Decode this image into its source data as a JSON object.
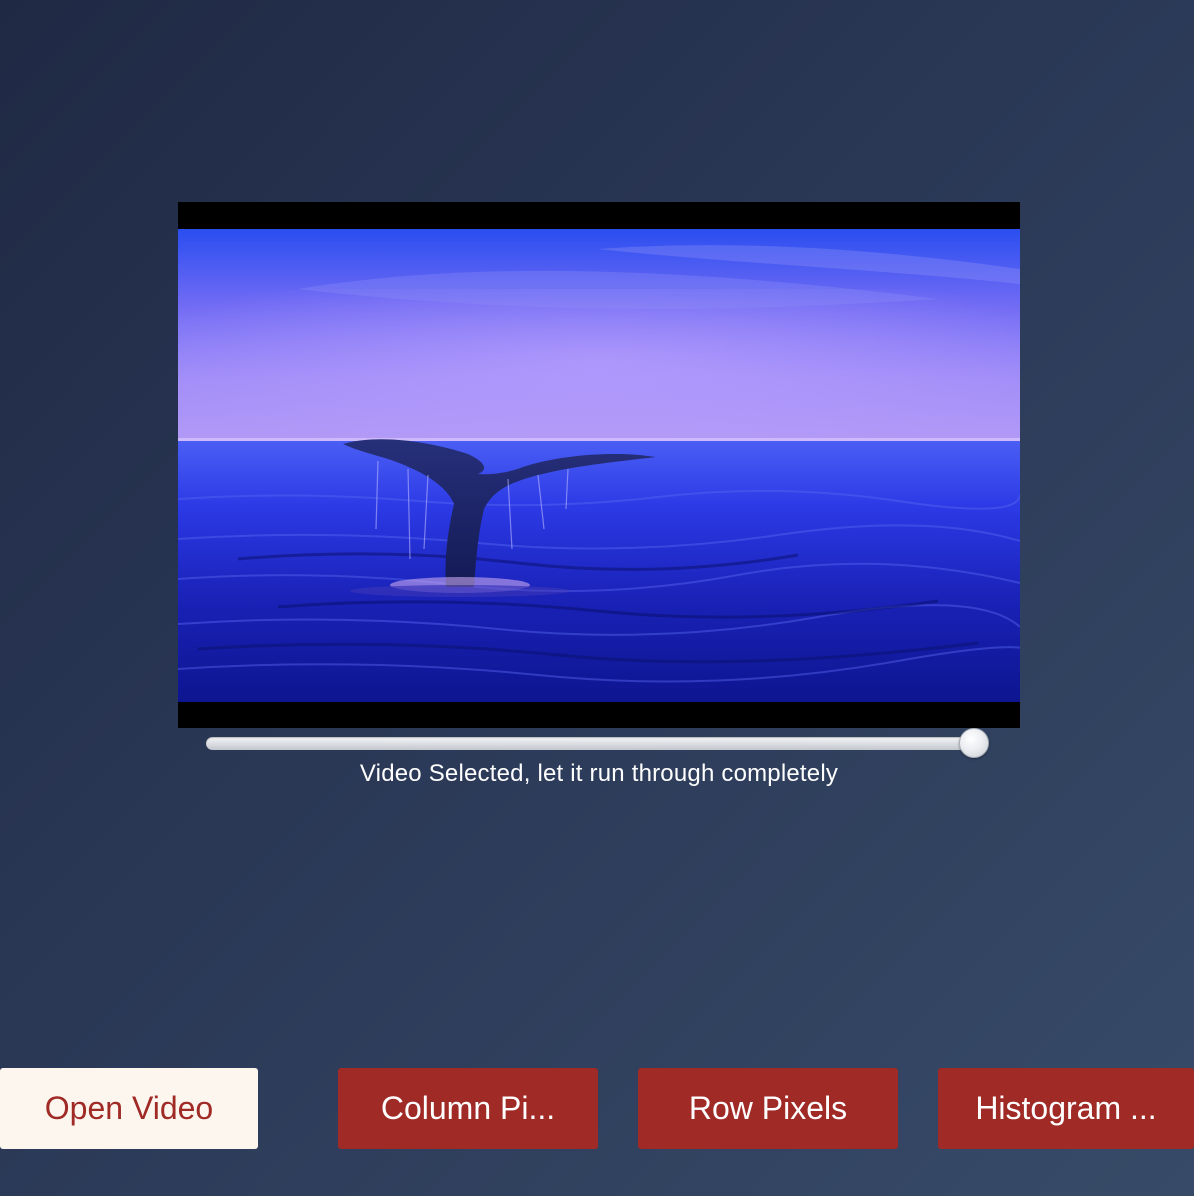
{
  "video": {
    "content": "whale tail rising from blue ocean at dusk"
  },
  "playback": {
    "progress": 1.0
  },
  "status": {
    "text": "Video Selected, let it run through completely"
  },
  "buttons": {
    "open_video": "Open Video",
    "column_pixels": "Column Pi...",
    "row_pixels": "Row Pixels",
    "histogram": "Histogram ..."
  },
  "colors": {
    "accent": "#a02a26",
    "button_light_bg": "#fdf6ef",
    "background_top": "#1f2944",
    "background_bottom": "#374b68"
  }
}
